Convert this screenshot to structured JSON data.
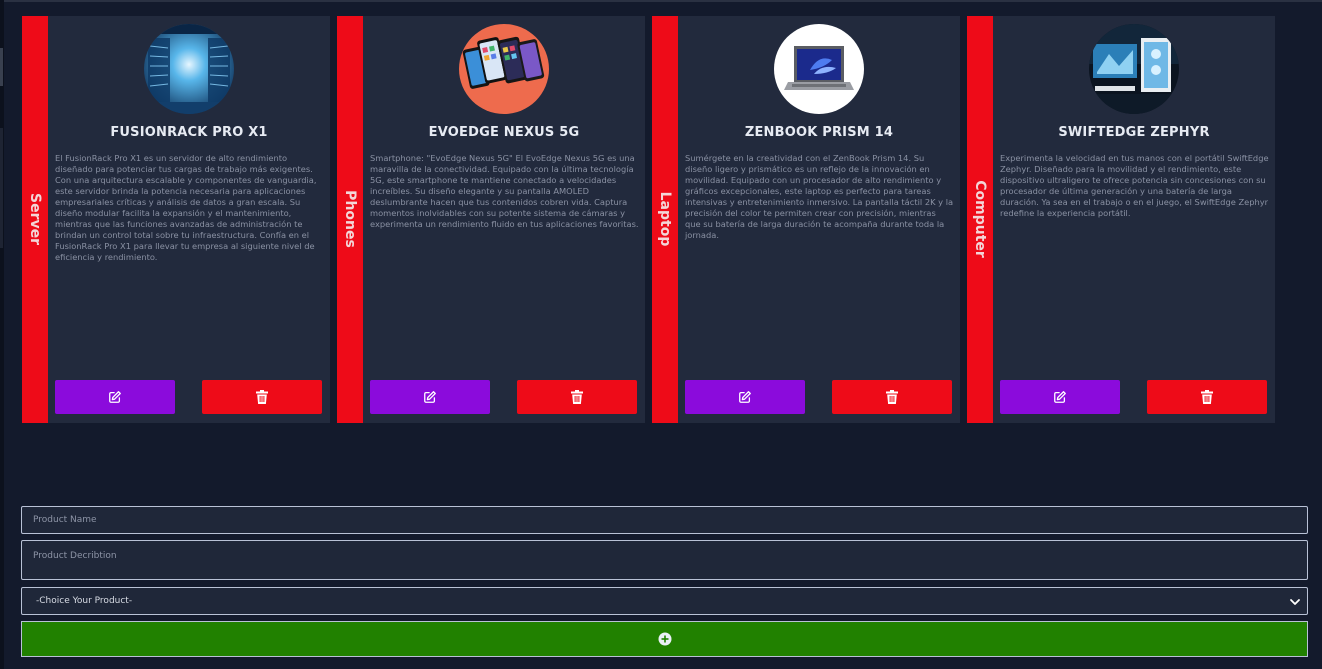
{
  "products": [
    {
      "category": "Server",
      "title": "FUSIONRACK PRO X1",
      "image": "server-room-photo",
      "description": "El FusionRack Pro X1 es un servidor de alto rendimiento diseñado para potenciar tus cargas de trabajo más exigentes. Con una arquitectura escalable y componentes de vanguardia, este servidor brinda la potencia necesaria para aplicaciones empresariales críticas y análisis de datos a gran escala. Su diseño modular facilita la expansión y el mantenimiento, mientras que las funciones avanzadas de administración te brindan un control total sobre tu infraestructura. Confía en el FusionRack Pro X1 para llevar tu empresa al siguiente nivel de eficiencia y rendimiento."
    },
    {
      "category": "Phones",
      "title": "EVOEDGE NEXUS 5G",
      "image": "smartphones-photo",
      "description": "Smartphone: \"EvoEdge Nexus 5G\" El EvoEdge Nexus 5G es una maravilla de la conectividad. Equipado con la última tecnología 5G, este smartphone te mantiene conectado a velocidades increíbles. Su diseño elegante y su pantalla AMOLED deslumbrante hacen que tus contenidos cobren vida. Captura momentos inolvidables con su potente sistema de cámaras y experimenta un rendimiento fluido en tus aplicaciones favoritas."
    },
    {
      "category": "Laptop",
      "title": "ZENBOOK PRISM 14",
      "image": "laptop-photo",
      "description": "Sumérgete en la creatividad con el ZenBook Prism 14. Su diseño ligero y prismático es un reflejo de la innovación en movilidad. Equipado con un procesador de alto rendimiento y gráficos excepcionales, este laptop es perfecto para tareas intensivas y entretenimiento inmersivo. La pantalla táctil 2K y la precisión del color te permiten crear con precisión, mientras que su batería de larga duración te acompaña durante toda la jornada."
    },
    {
      "category": "Computer",
      "title": "SWIFTEDGE ZEPHYR",
      "image": "desktop-computer-photo",
      "description": "Experimenta la velocidad en tus manos con el portátil SwiftEdge Zephyr. Diseñado para la movilidad y el rendimiento, este dispositivo ultraligero te ofrece potencia sin concesiones con su procesador de última generación y una batería de larga duración. Ya sea en el trabajo o en el juego, el SwiftEdge Zephyr redefine la experiencia portátil."
    }
  ],
  "form": {
    "name_placeholder": "Product Name",
    "description_placeholder": "Product Decribtion",
    "select_value": "-Choice Your Product-",
    "add_icon": "plus-circle-icon"
  },
  "colors": {
    "background": "#131a2c",
    "card": "#222a3d",
    "category_stripe": "#ee0b18",
    "edit_button": "#8b0bdc",
    "delete_button": "#ee0b18",
    "add_button": "#218100"
  }
}
